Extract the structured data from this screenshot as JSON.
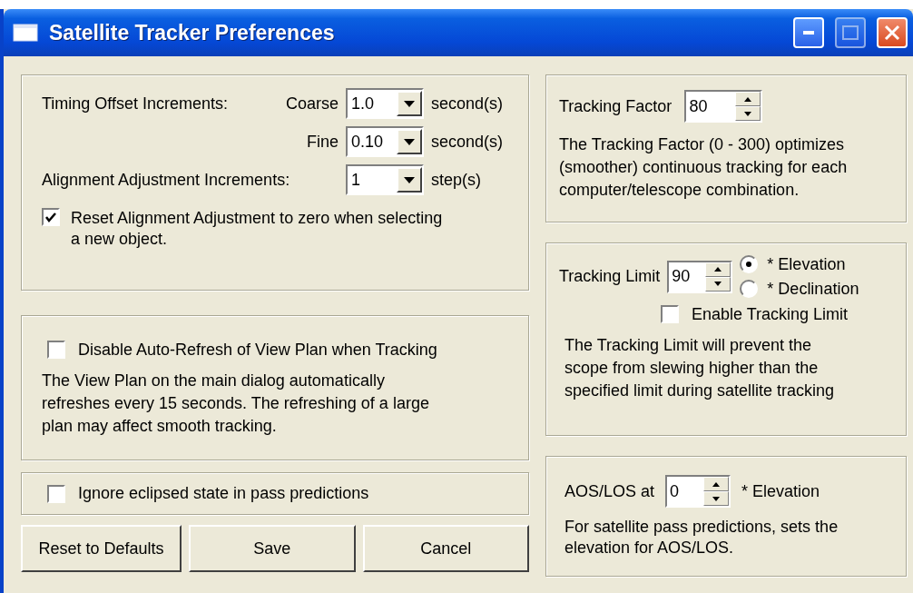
{
  "window": {
    "title": "Satellite Tracker Preferences"
  },
  "timing": {
    "label": "Timing Offset Increments:",
    "rows": [
      {
        "label": "Coarse",
        "value": "1.0",
        "unit": "second(s)"
      },
      {
        "label": "Fine",
        "value": "0.10",
        "unit": "second(s)"
      }
    ]
  },
  "alignment": {
    "label": "Alignment Adjustment Increments:",
    "value": "1",
    "unit": "step(s)"
  },
  "reset_alignment": {
    "label": "Reset Alignment Adjustment to zero when selecting\na new object.",
    "checked": true
  },
  "auto_refresh": {
    "label": "Disable Auto-Refresh of View Plan when Tracking",
    "checked": false,
    "description": "The View Plan on the main dialog automatically\nrefreshes every 15 seconds. The refreshing of a large\nplan may affect smooth tracking."
  },
  "ignore_eclipsed": {
    "label": "Ignore eclipsed state in pass predictions",
    "checked": false
  },
  "buttons": [
    "Reset to Defaults",
    "Save",
    "Cancel"
  ],
  "tracking_factor": {
    "label": "Tracking Factor",
    "value": "80",
    "description": "The Tracking Factor (0 - 300) optimizes\n(smoother) continuous tracking for each\ncomputer/telescope combination."
  },
  "tracking_limit": {
    "label": "Tracking Limit",
    "value": "90",
    "options": [
      {
        "label": "* Elevation",
        "selected": true
      },
      {
        "label": "* Declination",
        "selected": false
      }
    ],
    "enable": {
      "label": "Enable Tracking Limit",
      "checked": false
    },
    "description": "The Tracking Limit will prevent the\nscope from slewing higher than the\nspecified limit during satellite tracking"
  },
  "aos_los": {
    "label": "AOS/LOS at",
    "value": "0",
    "unit": "* Elevation",
    "description": "For satellite pass predictions, sets the\nelevation for AOS/LOS."
  }
}
